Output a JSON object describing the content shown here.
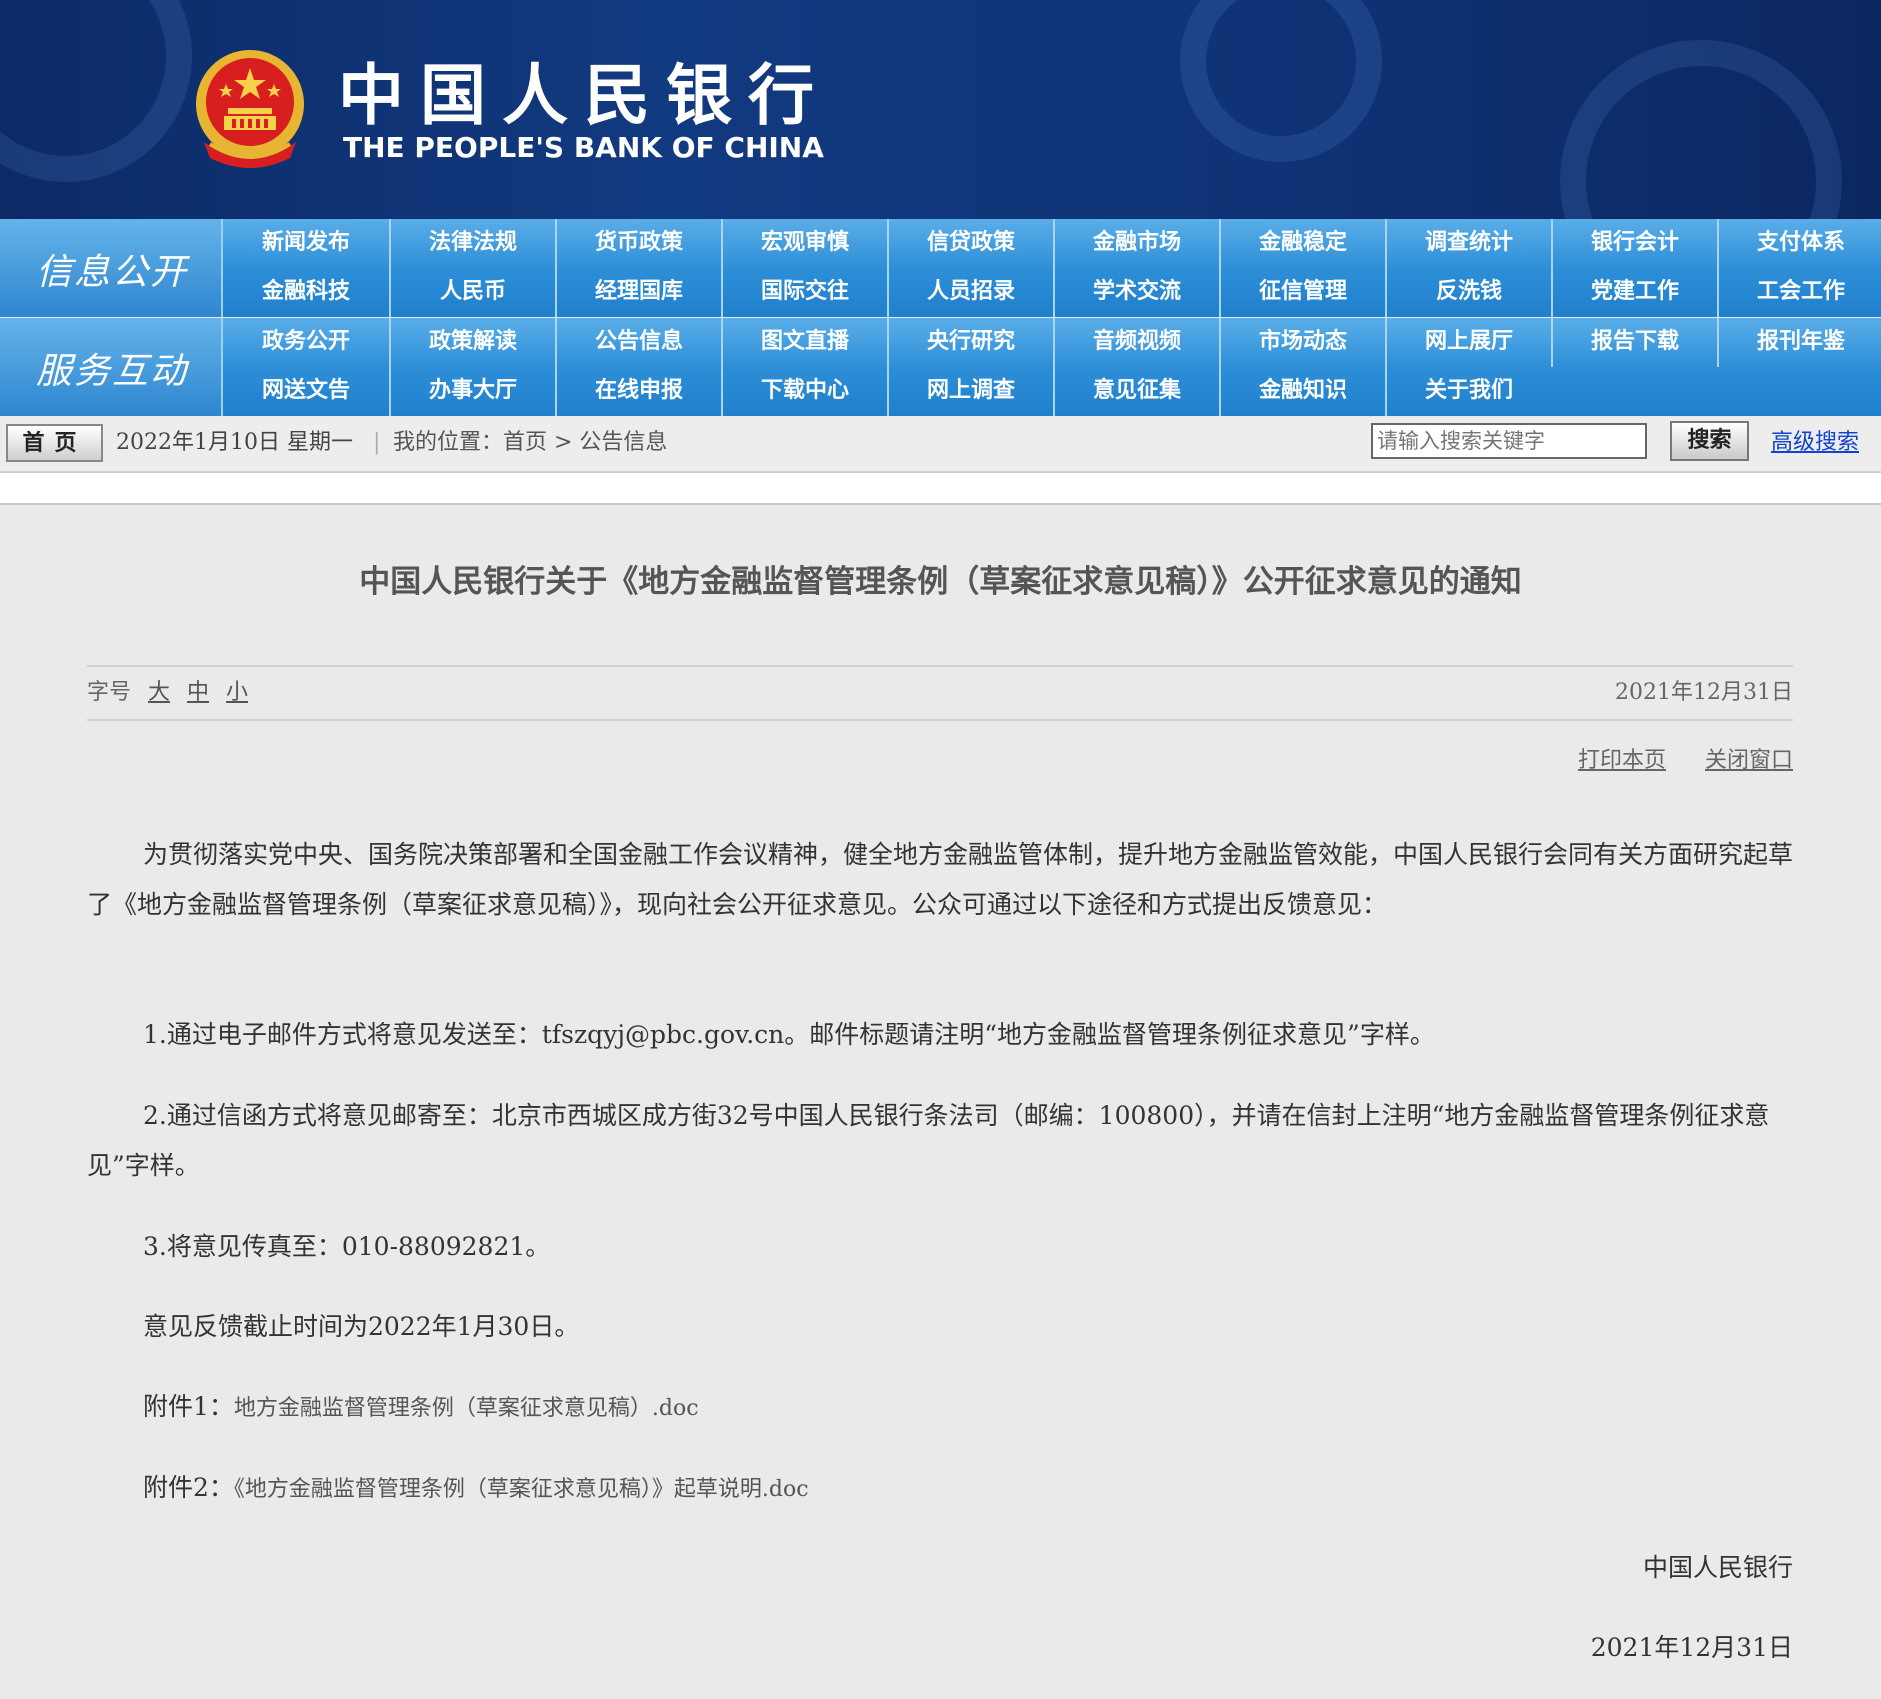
{
  "header": {
    "logo_cn": "中国人民银行",
    "logo_en": "THE PEOPLE'S BANK OF CHINA",
    "emblem_icon": "national-emblem-icon"
  },
  "nav": {
    "band1_label": "信息公开",
    "band1_row1": [
      "新闻发布",
      "法律法规",
      "货币政策",
      "宏观审慎",
      "信贷政策",
      "金融市场",
      "金融稳定",
      "调查统计",
      "银行会计",
      "支付体系"
    ],
    "band1_row2": [
      "金融科技",
      "人民币",
      "经理国库",
      "国际交往",
      "人员招录",
      "学术交流",
      "征信管理",
      "反洗钱",
      "党建工作",
      "工会工作"
    ],
    "band2_label": "服务互动",
    "band2_row1": [
      "政务公开",
      "政策解读",
      "公告信息",
      "图文直播",
      "央行研究",
      "音频视频",
      "市场动态",
      "网上展厅",
      "报告下载",
      "报刊年鉴"
    ],
    "band2_row2": [
      "网送文告",
      "办事大厅",
      "在线申报",
      "下载中心",
      "网上调查",
      "意见征集",
      "金融知识",
      "关于我们"
    ]
  },
  "locbar": {
    "home": "首页",
    "date": "2022年1月10日 星期一",
    "separator": "|",
    "position": "我的位置：首页  >  公告信息",
    "search_placeholder": "请输入搜索关键字",
    "search_button": "搜索",
    "advanced_search": "高级搜索"
  },
  "article": {
    "title": "中国人民银行关于《地方金融监督管理条例（草案征求意见稿）》公开征求意见的通知",
    "font_size_label": "字号",
    "font_sizes": [
      "大",
      "中",
      "小"
    ],
    "date": "2021年12月31日",
    "print": "打印本页",
    "close": "关闭窗口",
    "paragraphs": [
      "为贯彻落实党中央、国务院决策部署和全国金融工作会议精神，健全地方金融监管体制，提升地方金融监管效能，中国人民银行会同有关方面研究起草了《地方金融监督管理条例（草案征求意见稿）》，现向社会公开征求意见。公众可通过以下途径和方式提出反馈意见：",
      "1.通过电子邮件方式将意见发送至：tfszqyj@pbc.gov.cn。邮件标题请注明“地方金融监督管理条例征求意见”字样。",
      "2.通过信函方式将意见邮寄至：北京市西城区成方街32号中国人民银行条法司（邮编：100800），并请在信封上注明“地方金融监督管理条例征求意见”字样。",
      "3.将意见传真至：010-88092821。",
      "意见反馈截止时间为2022年1月30日。"
    ],
    "attachments": [
      {
        "label": "附件1：",
        "file": "地方金融监督管理条例（草案征求意见稿）.doc"
      },
      {
        "label": "附件2：",
        "file": "《地方金融监督管理条例（草案征求意见稿）》起草说明.doc"
      }
    ],
    "signature": "中国人民银行",
    "signature_date": "2021年12月31日"
  },
  "colors": {
    "header_bg": "#123a80",
    "nav_blue": "#2e8fd8",
    "page_bg": "#eaeaea",
    "link_blue": "#1144cc"
  }
}
